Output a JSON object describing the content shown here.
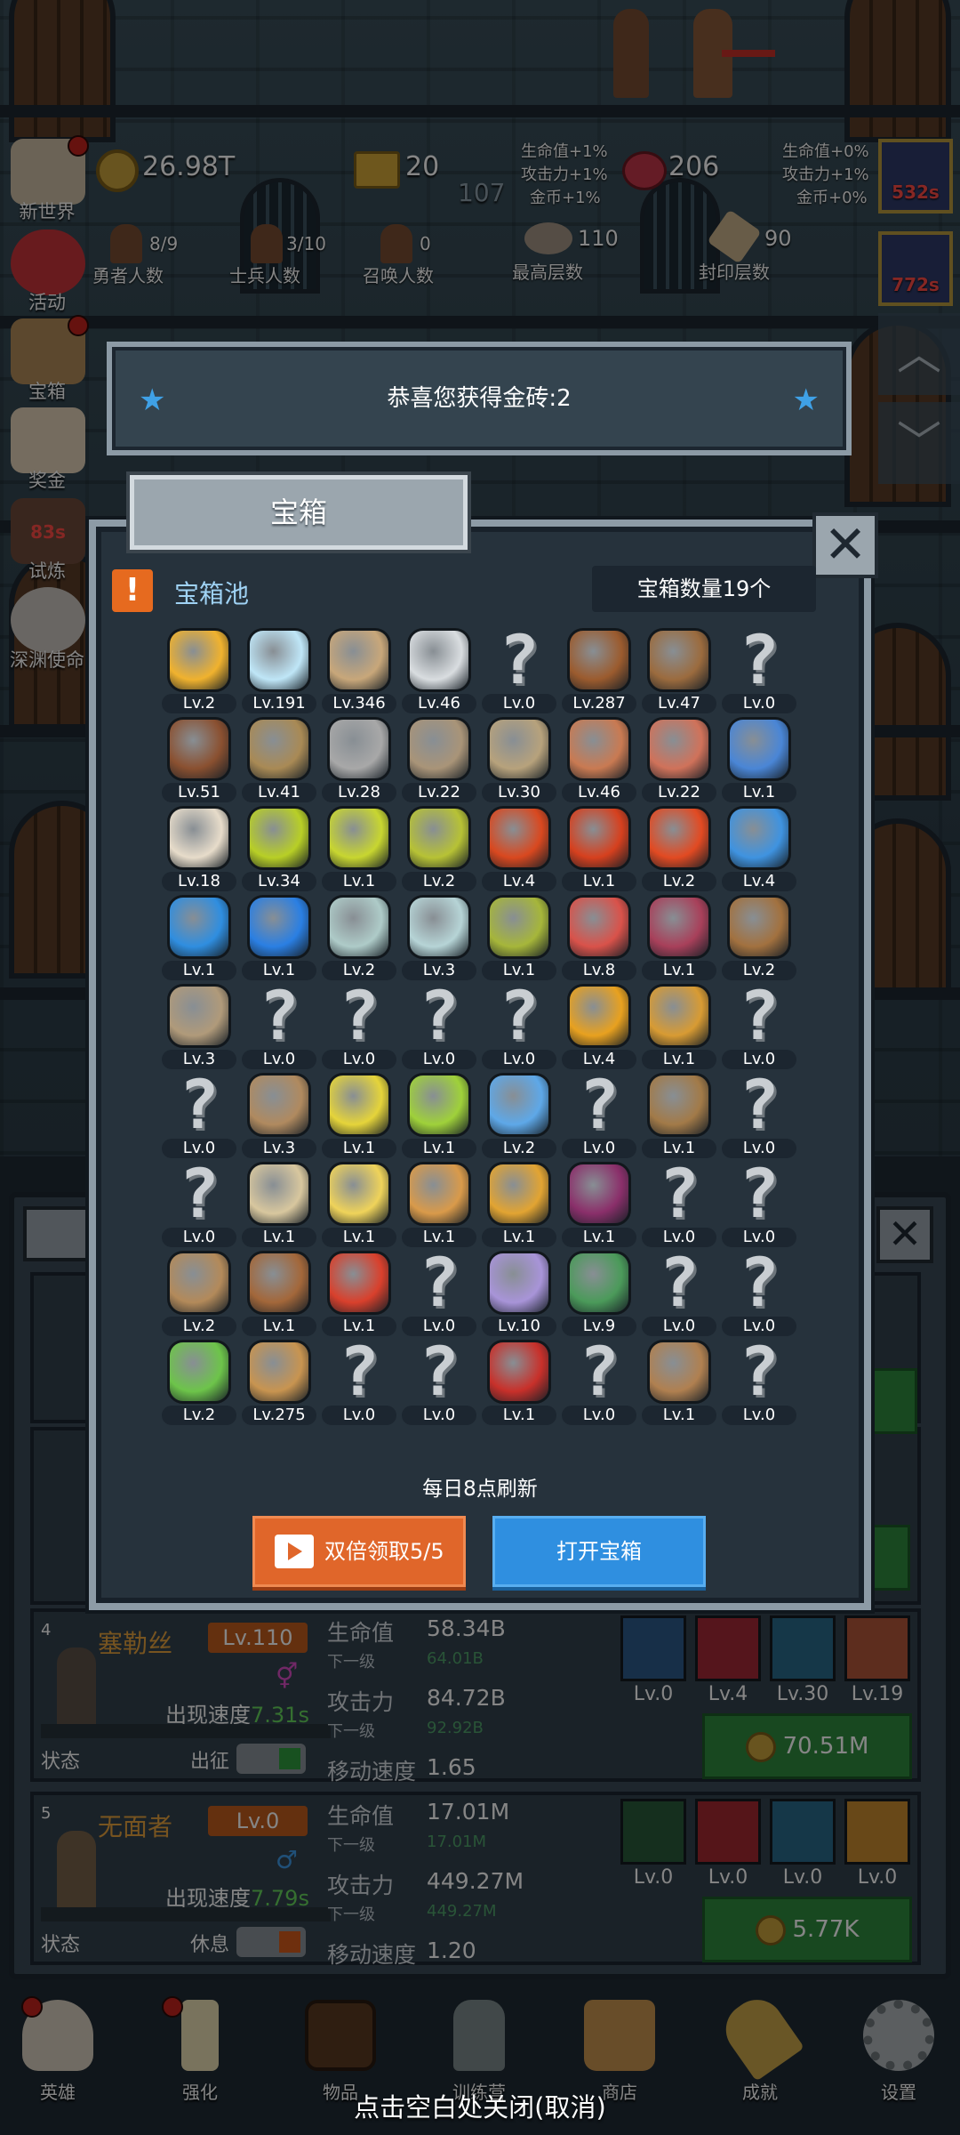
{
  "hud": {
    "gold": "26.98T",
    "bricks": "20",
    "meat": "206",
    "center_level": "107",
    "bonus_left": [
      "生命值+1%",
      "攻击力+1%",
      "金币+1%"
    ],
    "bonus_right": [
      "生命值+0%",
      "攻击力+1%",
      "金币+0%"
    ],
    "stats": [
      {
        "value": "8/9",
        "label": "勇者人数"
      },
      {
        "value": "3/10",
        "label": "士兵人数"
      },
      {
        "value": "0",
        "label": "召唤人数"
      },
      {
        "value": "110",
        "label": "最高层数"
      },
      {
        "value": "90",
        "label": "封印层数"
      }
    ],
    "timers": [
      "532s",
      "772s"
    ]
  },
  "sidebar": [
    {
      "label": "新世界",
      "icon": "map-scroll-icon",
      "dot": true
    },
    {
      "label": "活动",
      "icon": "heart-icon",
      "dot": false
    },
    {
      "label": "宝箱",
      "icon": "treasure-chest-icon",
      "dot": true
    },
    {
      "label": "奖金",
      "icon": "envelope-icon",
      "dot": false
    },
    {
      "label": "试炼",
      "icon": "trial-icon",
      "dot": false,
      "timer": "83s"
    },
    {
      "label": "深渊使命",
      "icon": "abyss-orb-icon",
      "dot": false
    }
  ],
  "notice": {
    "text": "恭喜您获得金砖:2"
  },
  "dialog": {
    "title": "宝箱",
    "pool_label": "宝箱池",
    "count_label": "宝箱数量19个",
    "refresh_text": "每日8点刷新",
    "double_button": "双倍领取5/5",
    "open_button": "打开宝箱"
  },
  "items": [
    {
      "name": "crown-icon",
      "lv": "Lv.2",
      "c": "#f0b22e"
    },
    {
      "name": "diamond-icon",
      "lv": "Lv.191",
      "c": "#bfe6f7"
    },
    {
      "name": "sword-icon",
      "lv": "Lv.346",
      "c": "#c8a77a"
    },
    {
      "name": "sword-icon",
      "lv": "Lv.46",
      "c": "#d9dde0"
    },
    {
      "name": "unknown-item-icon",
      "lv": "Lv.0",
      "c": ""
    },
    {
      "name": "armor-icon",
      "lv": "Lv.287",
      "c": "#9b5b2e"
    },
    {
      "name": "backpack-icon",
      "lv": "Lv.47",
      "c": "#9b6b3e"
    },
    {
      "name": "unknown-item-icon",
      "lv": "Lv.0",
      "c": ""
    },
    {
      "name": "leather-helmet-icon",
      "lv": "Lv.51",
      "c": "#8a5030"
    },
    {
      "name": "dagger-icon",
      "lv": "Lv.41",
      "c": "#a98a55"
    },
    {
      "name": "knight-helmet-icon",
      "lv": "Lv.28",
      "c": "#a8a8a8"
    },
    {
      "name": "hammer-icon",
      "lv": "Lv.22",
      "c": "#a99478"
    },
    {
      "name": "great-helm-icon",
      "lv": "Lv.30",
      "c": "#b7a27c"
    },
    {
      "name": "ham-icon",
      "lv": "Lv.46",
      "c": "#c97a52"
    },
    {
      "name": "steak-icon",
      "lv": "Lv.22",
      "c": "#d0725a"
    },
    {
      "name": "pouch-icon",
      "lv": "Lv.1",
      "c": "#4a86d6"
    },
    {
      "name": "bread-bowl-icon",
      "lv": "Lv.18",
      "c": "#e7dcca"
    },
    {
      "name": "yellow-potion-icon",
      "lv": "Lv.34",
      "c": "#b8cf26"
    },
    {
      "name": "yellow-potion-icon",
      "lv": "Lv.1",
      "c": "#c8d630"
    },
    {
      "name": "yellow-potion-icon",
      "lv": "Lv.2",
      "c": "#b7c235"
    },
    {
      "name": "red-potion-icon",
      "lv": "Lv.4",
      "c": "#d9481f"
    },
    {
      "name": "red-potion-icon",
      "lv": "Lv.1",
      "c": "#d6401e"
    },
    {
      "name": "red-potion-icon",
      "lv": "Lv.2",
      "c": "#e24a22"
    },
    {
      "name": "blue-potion-icon",
      "lv": "Lv.4",
      "c": "#3f93e0"
    },
    {
      "name": "blue-jar-icon",
      "lv": "Lv.1",
      "c": "#2f8ee0"
    },
    {
      "name": "blue-potion-icon",
      "lv": "Lv.1",
      "c": "#2a7fe3"
    },
    {
      "name": "empty-bottle-icon",
      "lv": "Lv.2",
      "c": "#aecbc8"
    },
    {
      "name": "empty-bottle-icon",
      "lv": "Lv.3",
      "c": "#b6d4d6"
    },
    {
      "name": "olive-bottle-icon",
      "lv": "Lv.1",
      "c": "#a6b63a"
    },
    {
      "name": "red-bottle-icon",
      "lv": "Lv.8",
      "c": "#d9524a"
    },
    {
      "name": "winged-boot-icon",
      "lv": "Lv.1",
      "c": "#a8405a"
    },
    {
      "name": "boot-icon",
      "lv": "Lv.2",
      "c": "#a2713f"
    },
    {
      "name": "shoe-icon",
      "lv": "Lv.3",
      "c": "#b09a7a"
    },
    {
      "name": "unknown-item-icon",
      "lv": "Lv.0",
      "c": ""
    },
    {
      "name": "unknown-item-icon",
      "lv": "Lv.0",
      "c": ""
    },
    {
      "name": "unknown-item-icon",
      "lv": "Lv.0",
      "c": ""
    },
    {
      "name": "unknown-item-icon",
      "lv": "Lv.0",
      "c": ""
    },
    {
      "name": "torch-icon",
      "lv": "Lv.4",
      "c": "#e8a11f"
    },
    {
      "name": "torch-icon",
      "lv": "Lv.1",
      "c": "#d89b33"
    },
    {
      "name": "unknown-item-icon",
      "lv": "Lv.0",
      "c": ""
    },
    {
      "name": "unknown-item-icon",
      "lv": "Lv.0",
      "c": ""
    },
    {
      "name": "wooden-staff-icon",
      "lv": "Lv.3",
      "c": "#b08a5f"
    },
    {
      "name": "lemon-icon",
      "lv": "Lv.1",
      "c": "#e5d43a"
    },
    {
      "name": "lime-icon",
      "lv": "Lv.1",
      "c": "#9fd13a"
    },
    {
      "name": "crystal-staff-icon",
      "lv": "Lv.2",
      "c": "#5ea8e8"
    },
    {
      "name": "unknown-item-icon",
      "lv": "Lv.0",
      "c": ""
    },
    {
      "name": "backpack-icon",
      "lv": "Lv.1",
      "c": "#a27a48"
    },
    {
      "name": "unknown-item-icon",
      "lv": "Lv.0",
      "c": ""
    },
    {
      "name": "unknown-item-icon",
      "lv": "Lv.0",
      "c": ""
    },
    {
      "name": "bone-club-icon",
      "lv": "Lv.1",
      "c": "#d8c79e"
    },
    {
      "name": "cheese-icon",
      "lv": "Lv.1",
      "c": "#efd35a"
    },
    {
      "name": "pie-icon",
      "lv": "Lv.1",
      "c": "#d99a4a"
    },
    {
      "name": "honey-jar-icon",
      "lv": "Lv.1",
      "c": "#e2a432"
    },
    {
      "name": "dark-crystal-icon",
      "lv": "Lv.1",
      "c": "#8a2f6a"
    },
    {
      "name": "unknown-item-icon",
      "lv": "Lv.0",
      "c": ""
    },
    {
      "name": "unknown-item-icon",
      "lv": "Lv.0",
      "c": ""
    },
    {
      "name": "bow-icon",
      "lv": "Lv.2",
      "c": "#b38a5a"
    },
    {
      "name": "quiver-icon",
      "lv": "Lv.1",
      "c": "#a3673a"
    },
    {
      "name": "flame-shield-icon",
      "lv": "Lv.1",
      "c": "#d9402c"
    },
    {
      "name": "unknown-item-icon",
      "lv": "Lv.0",
      "c": ""
    },
    {
      "name": "rune-stone-icon",
      "lv": "Lv.10",
      "c": "#a894d8"
    },
    {
      "name": "emblem-shield-icon",
      "lv": "Lv.9",
      "c": "#4b9a5a"
    },
    {
      "name": "unknown-item-icon",
      "lv": "Lv.0",
      "c": ""
    },
    {
      "name": "unknown-item-icon",
      "lv": "Lv.0",
      "c": ""
    },
    {
      "name": "green-wand-icon",
      "lv": "Lv.2",
      "c": "#6dc44a"
    },
    {
      "name": "beer-mug-icon",
      "lv": "Lv.275",
      "c": "#c89450"
    },
    {
      "name": "unknown-item-icon",
      "lv": "Lv.0",
      "c": ""
    },
    {
      "name": "unknown-item-icon",
      "lv": "Lv.0",
      "c": ""
    },
    {
      "name": "red-book-icon",
      "lv": "Lv.1",
      "c": "#c8302a"
    },
    {
      "name": "unknown-item-icon",
      "lv": "Lv.0",
      "c": ""
    },
    {
      "name": "whip-icon",
      "lv": "Lv.1",
      "c": "#b08050"
    },
    {
      "name": "unknown-item-icon",
      "lv": "Lv.0",
      "c": ""
    }
  ],
  "heroes": [
    {
      "num": "4",
      "name": "塞勒丝",
      "lv": "Lv.110",
      "gender": "⚥",
      "speed_label": "出现速度",
      "speed": "7.31s",
      "hp_label": "生命值",
      "hp": "58.34B",
      "next_label": "下一级",
      "hp_next": "64.01B",
      "atk_label": "攻击力",
      "atk": "84.72B",
      "atk_next": "92.92B",
      "move_label": "移动速度",
      "move": "1.65",
      "state_label": "状态",
      "action": "出征",
      "toggle_color": "#2f9b3e",
      "skills": [
        {
          "name": "star-shield-skill-icon",
          "lv": "Lv.0",
          "c": "#2c5a8a"
        },
        {
          "name": "beast-fang-skill-icon",
          "lv": "Lv.4",
          "c": "#a42a36"
        },
        {
          "name": "armored-legs-skill-icon",
          "lv": "Lv.30",
          "c": "#2a6a8a"
        },
        {
          "name": "cross-blades-skill-icon",
          "lv": "Lv.19",
          "c": "#b2563a"
        }
      ],
      "cost": "70.51M"
    },
    {
      "num": "5",
      "name": "无面者",
      "lv": "Lv.0",
      "gender": "♂",
      "speed_label": "出现速度",
      "speed": "7.79s",
      "hp_label": "生命值",
      "hp": "17.01M",
      "next_label": "下一级",
      "hp_next": "17.01M",
      "atk_label": "攻击力",
      "atk": "449.27M",
      "atk_next": "449.27M",
      "move_label": "移动速度",
      "move": "1.20",
      "state_label": "状态",
      "action": "休息",
      "toggle_color": "#d35a1c",
      "skills": [
        {
          "name": "slash-skill-icon",
          "lv": "Lv.0",
          "c": "#2a5a3a"
        },
        {
          "name": "sword-skill-icon",
          "lv": "Lv.0",
          "c": "#a42a30"
        },
        {
          "name": "cannon-skill-icon",
          "lv": "Lv.0",
          "c": "#2a6a8a"
        },
        {
          "name": "warrior-face-skill-icon",
          "lv": "Lv.0",
          "c": "#c88a2e"
        }
      ],
      "cost": "5.77K"
    }
  ],
  "nav": [
    {
      "label": "英雄",
      "icon": "skull-icon",
      "dot": true
    },
    {
      "label": "强化",
      "icon": "candle-icon",
      "dot": true
    },
    {
      "label": "物品",
      "icon": "book-icon",
      "dot": false
    },
    {
      "label": "训练营",
      "icon": "lantern-icon",
      "dot": false
    },
    {
      "label": "商店",
      "icon": "beer-mug-icon",
      "dot": false
    },
    {
      "label": "成就",
      "icon": "key-icon",
      "dot": false
    },
    {
      "label": "设置",
      "icon": "gear-icon",
      "dot": false
    }
  ],
  "close_hint": "点击空白处关闭(取消)"
}
